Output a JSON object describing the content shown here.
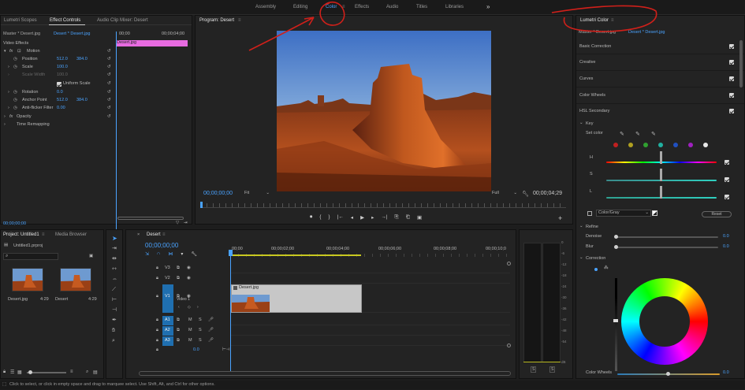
{
  "workspaces": [
    "Assembly",
    "Editing",
    "Color",
    "Effects",
    "Audio",
    "Titles",
    "Libraries"
  ],
  "active_workspace": "Color",
  "more_glyph": "»",
  "source_tabs": [
    "Lumetri Scopes",
    "Effect Controls",
    "Audio Clip Mixer: Desert"
  ],
  "ec": {
    "master_label": "Master * Desert.jpg",
    "clip_label": "Desert * Desert.jpg",
    "timecodes": [
      "00;00",
      "00;00;04;00"
    ],
    "clip_bar": "Desert.jpg",
    "video_effects": "Video Effects",
    "motion": "Motion",
    "position_label": "Position",
    "position_x": "512.0",
    "position_y": "384.0",
    "scale_label": "Scale",
    "scale_val": "100.0",
    "scale_width_label": "Scale Width",
    "scale_width_val": "100.0",
    "uniform_scale": "Uniform Scale",
    "rotation_label": "Rotation",
    "rotation_val": "0.0",
    "anchor_label": "Anchor Point",
    "anchor_x": "512.0",
    "anchor_y": "384.0",
    "antiflicker_label": "Anti-flicker Filter",
    "antiflicker_val": "0.00",
    "opacity": "Opacity",
    "time_remap": "Time Remapping",
    "bottom_tc": "00;00;00;00"
  },
  "program": {
    "tab": "Program: Desert",
    "tc_left": "00;00;00;00",
    "fit": "Fit",
    "full": "Full",
    "tc_right": "00;00;04;29",
    "transport": [
      "⏺",
      "{",
      "}",
      "|←",
      "◂",
      "▶",
      "▸",
      "→|",
      "⎘",
      "⎗",
      "▣"
    ],
    "add": "+"
  },
  "project": {
    "tab": "Project: Untitled1",
    "tab2": "Media Browser",
    "file": "Untitled1.prproj",
    "items": [
      {
        "name": "Desert.jpg",
        "dur": "4:29"
      },
      {
        "name": "Desert",
        "dur": "4:29"
      }
    ]
  },
  "timeline": {
    "tab": "Desert",
    "tc": "00;00;00;00",
    "ruler": [
      "00;00",
      "00;00;02;00",
      "00;00;04;00",
      "00;00;06;00",
      "00;00;08;00",
      "00;00;10;0"
    ],
    "video_tracks": [
      {
        "name": "V3"
      },
      {
        "name": "V2"
      },
      {
        "name": "V1",
        "label": "Video 1"
      }
    ],
    "audio_tracks": [
      {
        "name": "A1"
      },
      {
        "name": "A2"
      },
      {
        "name": "A3"
      }
    ],
    "mix_val": "0.0",
    "clip_name": "Desert.jpg"
  },
  "meter": {
    "ticks": [
      "0",
      "-6",
      "-12",
      "-18",
      "-24",
      "-30",
      "-36",
      "-42",
      "-48",
      "-54",
      "dB"
    ],
    "solo": [
      "S",
      "S"
    ]
  },
  "lumetri": {
    "tab": "Lumetri Color",
    "master_label": "Master * Desert.jpg",
    "clip_label": "Desert * Desert.jpg",
    "sections": [
      "Basic Correction",
      "Creative",
      "Curves",
      "Color Wheels",
      "HSL Secondary"
    ],
    "key": "Key",
    "set_color": "Set color",
    "swatches": [
      "#c02020",
      "#b0a020",
      "#30a030",
      "#20b0a0",
      "#2050c0",
      "#a020c0",
      "#e8e8e8"
    ],
    "h_label": "H",
    "s_label": "S",
    "l_label": "L",
    "color_gray": "Color/Gray",
    "reset": "Reset",
    "refine": "Refine",
    "denoise": "Denoise",
    "denoise_val": "0.0",
    "blur": "Blur",
    "blur_val": "0.0",
    "correction": "Correction",
    "wheels_label": "Color Wheels",
    "wheels_val": "0.0"
  },
  "status": "Click to select, or click in empty space and drag to marquee select. Use Shift, Alt, and Ctrl for other options.",
  "annotation_color": "#d0201a"
}
